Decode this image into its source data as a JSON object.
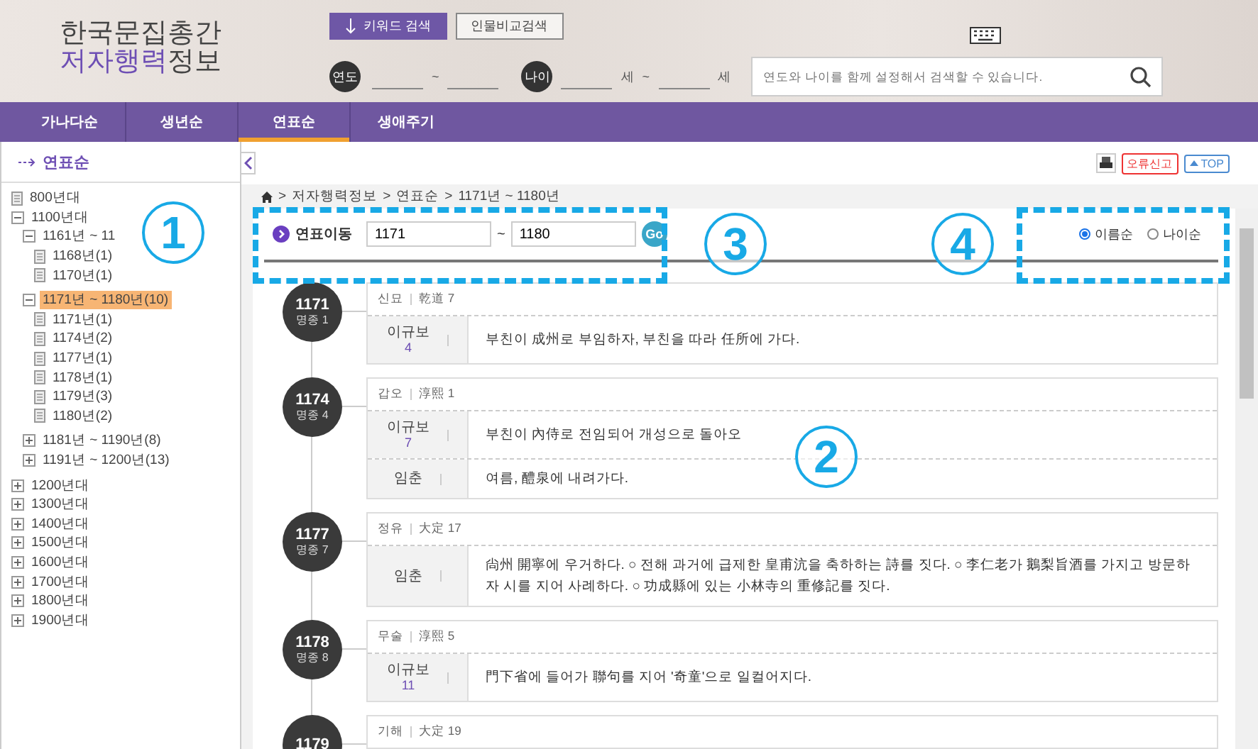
{
  "logo": {
    "line1": "한국문집총간",
    "line2_highlight": "저자행력",
    "line2_rest": "정보"
  },
  "search_modes": [
    {
      "label": "키워드 검색",
      "selected": true
    },
    {
      "label": "인물비교검색",
      "selected": false
    }
  ],
  "filters": {
    "year_label": "연도",
    "year_sep": "~",
    "age_label": "나이",
    "age_unit_from": "세",
    "age_sep": "~",
    "age_unit_to": "세"
  },
  "search": {
    "placeholder": "연도와 나이를 함께 설정해서 검색할 수 있습니다."
  },
  "nav_tabs": [
    {
      "label": "가나다순",
      "selected": false
    },
    {
      "label": "생년순",
      "selected": false
    },
    {
      "label": "연표순",
      "selected": true
    },
    {
      "label": "생애주기",
      "selected": false
    }
  ],
  "sidebar": {
    "title": "연표순",
    "items": [
      {
        "label": "800년대",
        "selected": false
      },
      {
        "label": "1100년대",
        "selected": false,
        "expanded": true,
        "children": [
          {
            "label": "1161년 ~ 11",
            "selected": false,
            "expanded": true,
            "children": [
              {
                "label": "1168년(1)",
                "selected": false
              },
              {
                "label": "1170년(1)",
                "selected": false
              }
            ]
          },
          {
            "label": "1171년 ~ 1180년(10)",
            "selected": true,
            "expanded": true,
            "children": [
              {
                "label": "1171년(1)",
                "selected": false
              },
              {
                "label": "1174년(2)",
                "selected": false
              },
              {
                "label": "1177년(1)",
                "selected": false
              },
              {
                "label": "1178년(1)",
                "selected": false
              },
              {
                "label": "1179년(3)",
                "selected": false
              },
              {
                "label": "1180년(2)",
                "selected": false
              }
            ]
          },
          {
            "label": "1181년 ~ 1190년(8)",
            "selected": false,
            "expanded": false
          },
          {
            "label": "1191년 ~ 1200년(13)",
            "selected": false,
            "expanded": false
          }
        ]
      },
      {
        "label": "1200년대",
        "selected": false,
        "expanded": false
      },
      {
        "label": "1300년대",
        "selected": false,
        "expanded": false
      },
      {
        "label": "1400년대",
        "selected": false,
        "expanded": false
      },
      {
        "label": "1500년대",
        "selected": false,
        "expanded": false
      },
      {
        "label": "1600년대",
        "selected": false,
        "expanded": false
      },
      {
        "label": "1700년대",
        "selected": false,
        "expanded": false
      },
      {
        "label": "1800년대",
        "selected": false,
        "expanded": false
      },
      {
        "label": "1900년대",
        "selected": false,
        "expanded": false
      }
    ]
  },
  "toolbar": {
    "report": "오류신고",
    "top": "TOP"
  },
  "breadcrumb": [
    "저자행력정보",
    "연표순",
    "1171년 ~ 1180년"
  ],
  "breadcrumb_sep": ">",
  "jump": {
    "label": "연표이동",
    "from": "1171",
    "sep": "~",
    "to": "1180",
    "go": "Go"
  },
  "sort": [
    {
      "label": "이름순",
      "selected": true
    },
    {
      "label": "나이순",
      "selected": false
    }
  ],
  "entries": [
    {
      "year": "1171",
      "king": "명종 1",
      "ganji": "신묘",
      "era": "乾道 7",
      "rows": [
        {
          "name": "이규보",
          "count": "4",
          "text": "부친이 成州로 부임하자, 부친을 따라 任所에 가다."
        }
      ]
    },
    {
      "year": "1174",
      "king": "명종 4",
      "ganji": "갑오",
      "era": "淳熙 1",
      "rows": [
        {
          "name": "이규보",
          "count": "7",
          "text": "부친이 內侍로 전임되어 개성으로 돌아오"
        },
        {
          "name": "임춘",
          "text": "여름, 醴泉에 내려가다."
        }
      ]
    },
    {
      "year": "1177",
      "king": "명종 7",
      "ganji": "정유",
      "era": "大定 17",
      "rows": [
        {
          "name": "임춘",
          "text": "尙州 開寧에 우거하다. ○ 전해 과거에 급제한 皇甫沆을 축하하는 詩를 짓다. ○ 李仁老가 鵝梨旨酒를 가지고 방문하자 시를 지어 사례하다. ○ 功成縣에 있는 小林寺의 重修記를 짓다."
        }
      ]
    },
    {
      "year": "1178",
      "king": "명종 8",
      "ganji": "무술",
      "era": "淳熙 5",
      "rows": [
        {
          "name": "이규보",
          "count": "11",
          "text": "門下省에 들어가 聯句를 지어 '奇童'으로 일컬어지다."
        }
      ]
    },
    {
      "year": "1179",
      "ganji": "기해",
      "era": "大定 19"
    }
  ],
  "callouts": [
    {
      "label": "1",
      "boxed": false
    },
    {
      "label": "3",
      "boxed": true
    },
    {
      "label": "4",
      "boxed": true
    },
    {
      "label": "2",
      "boxed": false
    }
  ]
}
